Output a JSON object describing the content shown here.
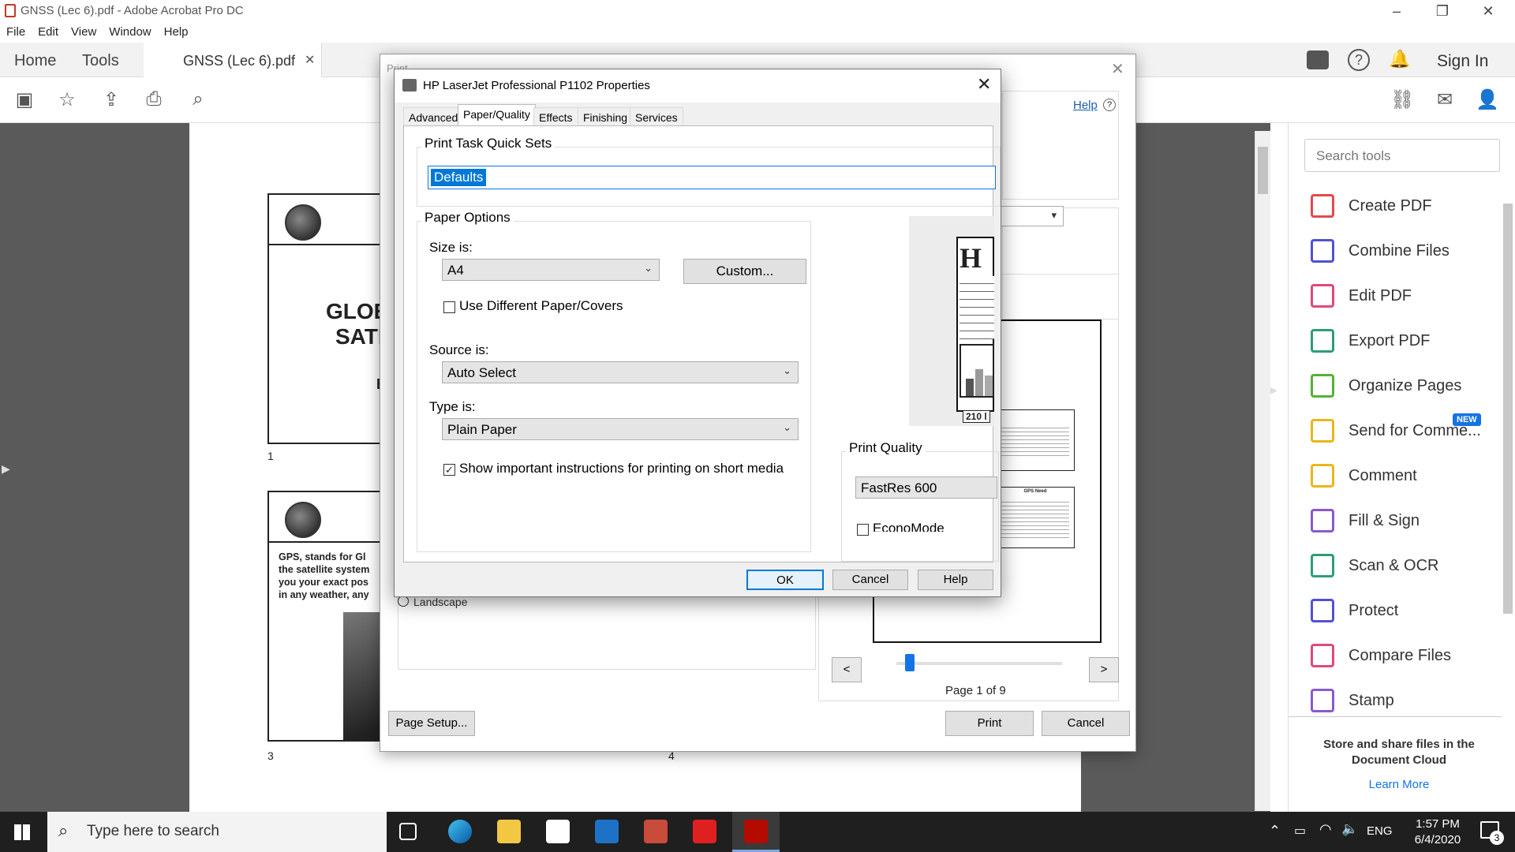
{
  "window": {
    "title": "GNSS (Lec 6).pdf - Adobe Acrobat Pro DC"
  },
  "menu": [
    "File",
    "Edit",
    "View",
    "Window",
    "Help"
  ],
  "tabs": {
    "home": "Home",
    "tools": "Tools",
    "document": "GNSS (Lec 6).pdf"
  },
  "header_right": {
    "sign_in": "Sign In"
  },
  "document": {
    "page1_title_line1": "GLOE",
    "page1_title_line2": "SATI",
    "page1_letter": "E",
    "page_num_1": "1",
    "page3_text_lines": [
      "GPS,  stands for Gl",
      "the satellite system",
      "you your exact pos",
      "in any weather, any"
    ],
    "page_num_3": "3",
    "page_num_4": "4"
  },
  "right_pane": {
    "search_placeholder": "Search tools",
    "tools": [
      {
        "label": "Create PDF",
        "icon": "create-pdf-icon",
        "color": "#e34850"
      },
      {
        "label": "Combine Files",
        "icon": "combine-files-icon",
        "color": "#5151d3"
      },
      {
        "label": "Edit PDF",
        "icon": "edit-pdf-icon",
        "color": "#e0497e"
      },
      {
        "label": "Export PDF",
        "icon": "export-pdf-icon",
        "color": "#2d9d78"
      },
      {
        "label": "Organize Pages",
        "icon": "organize-pages-icon",
        "color": "#55b136"
      },
      {
        "label": "Send for Comme...",
        "icon": "send-for-comment-icon",
        "color": "#e8b71a"
      },
      {
        "label": "Comment",
        "icon": "comment-icon",
        "color": "#e8b71a"
      },
      {
        "label": "Fill & Sign",
        "icon": "fill-sign-icon",
        "color": "#8a59d1"
      },
      {
        "label": "Scan & OCR",
        "icon": "scan-ocr-icon",
        "color": "#2d9d78"
      },
      {
        "label": "Protect",
        "icon": "protect-icon",
        "color": "#5151d3"
      },
      {
        "label": "Compare Files",
        "icon": "compare-files-icon",
        "color": "#e0497e"
      },
      {
        "label": "Stamp",
        "icon": "stamp-icon",
        "color": "#8a59d1"
      }
    ],
    "new_badge": "NEW",
    "store_text": "Store and share files in the Document Cloud",
    "learn_more": "Learn More"
  },
  "print_dialog": {
    "title": "Print",
    "help": "Help",
    "landscape": "Landscape",
    "page_setup": "Page Setup...",
    "page_indicator": "Page 1 of 9",
    "prev": "<",
    "next": ">",
    "print": "Print",
    "cancel": "Cancel",
    "preview_small_title": "GPS Need",
    "slider_fraction": 0.05
  },
  "properties": {
    "title": "HP LaserJet Professional P1102 Properties",
    "tabs": [
      "Advanced",
      "Paper/Quality",
      "Effects",
      "Finishing",
      "Services"
    ],
    "active_tab": "Paper/Quality",
    "quick_sets_label": "Print Task Quick Sets",
    "quick_sets_value": "Defaults",
    "paper_options_label": "Paper Options",
    "size_label": "Size is:",
    "size_value": "A4",
    "custom_button": "Custom...",
    "different_paper": "Use Different Paper/Covers",
    "different_paper_checked": false,
    "source_label": "Source is:",
    "source_value": "Auto Select",
    "type_label": "Type is:",
    "type_value": "Plain Paper",
    "show_instructions": "Show important instructions for printing on short media",
    "show_instructions_checked": true,
    "preview_dim": "210 l",
    "print_quality_label": "Print Quality",
    "print_quality_value": "FastRes 600",
    "econo_mode": "EconoMode",
    "ok": "OK",
    "cancel": "Cancel",
    "help": "Help"
  },
  "taskbar": {
    "search_placeholder": "Type here to search",
    "language": "ENG",
    "time": "1:57 PM",
    "date": "6/4/2020",
    "notifications": "3"
  }
}
